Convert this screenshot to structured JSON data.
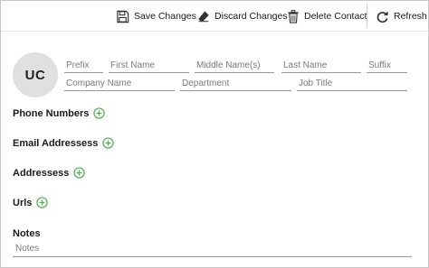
{
  "toolbar": {
    "save_label": "Save Changes",
    "discard_label": "Discard Changes",
    "delete_label": "Delete Contact",
    "refresh_label": "Refresh"
  },
  "avatar": {
    "initials": "UC"
  },
  "name_fields": {
    "prefix": {
      "placeholder": "Prefix",
      "value": ""
    },
    "first_name": {
      "placeholder": "First Name",
      "value": ""
    },
    "middle_name": {
      "placeholder": "Middle Name(s)",
      "value": ""
    },
    "last_name": {
      "placeholder": "Last Name",
      "value": ""
    },
    "suffix": {
      "placeholder": "Suffix",
      "value": ""
    }
  },
  "org_fields": {
    "company": {
      "placeholder": "Company Name",
      "value": ""
    },
    "department": {
      "placeholder": "Department",
      "value": ""
    },
    "job_title": {
      "placeholder": "Job Title",
      "value": ""
    }
  },
  "sections": {
    "phone": "Phone Numbers",
    "email": "Email Addressess",
    "address": "Addressess",
    "urls": "Urls"
  },
  "notes": {
    "label": "Notes",
    "placeholder": "Notes",
    "value": ""
  },
  "colors": {
    "add_icon": "#4caf50",
    "field_underline": "#9a9a9a",
    "avatar_bg": "#e0e0e0"
  }
}
